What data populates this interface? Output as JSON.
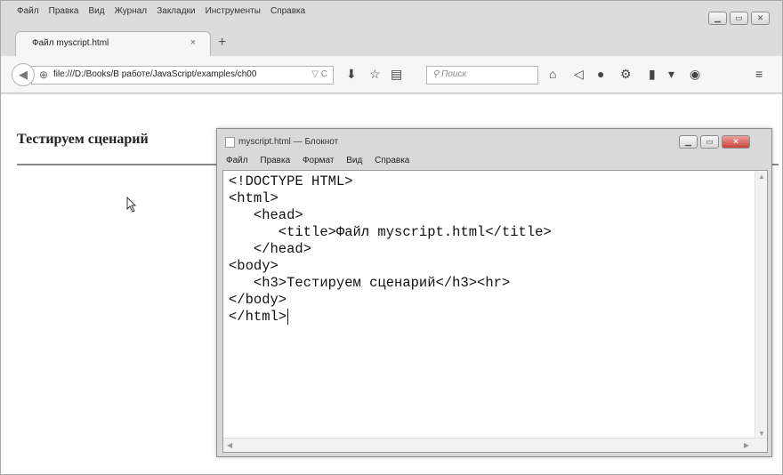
{
  "browser": {
    "menu": [
      "Файл",
      "Правка",
      "Вид",
      "Журнал",
      "Закладки",
      "Инструменты",
      "Справка"
    ],
    "tab_title": "Файл myscript.html",
    "tab_close": "×",
    "new_tab": "+",
    "url": "file:///D:/Books/В работе/JavaScript/examples/ch00",
    "url_tail": "▽ C",
    "search_placeholder": "Поиск"
  },
  "page": {
    "heading": "Тестируем сценарий"
  },
  "notepad": {
    "title": "myscript.html — Блокнот",
    "menu": [
      "Файл",
      "Правка",
      "Формат",
      "Вид",
      "Справка"
    ],
    "lines": [
      "<!DOCTYPE HTML>",
      "<html>",
      "   <head>",
      "      <title>Файл myscript.html</title>",
      "   </head>",
      "<body>",
      "   <h3>Тестируем сценарий</h3><hr>",
      "</body>",
      "</html>"
    ]
  }
}
